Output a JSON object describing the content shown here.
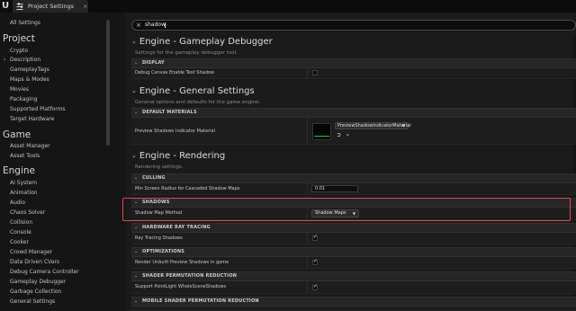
{
  "window": {
    "tab_title": "Project Settings",
    "close_glyph": "×"
  },
  "search": {
    "value": "shadow",
    "clear_glyph": "×"
  },
  "sidebar": {
    "top_link": "All Settings",
    "sections": [
      {
        "heading": "Project",
        "items": [
          "Crypto",
          "Description",
          "GameplayTags",
          "Maps & Modes",
          "Movies",
          "Packaging",
          "Supported Platforms",
          "Target Hardware"
        ],
        "current_item": "Description"
      },
      {
        "heading": "Game",
        "items": [
          "Asset Manager",
          "Asset Tools"
        ]
      },
      {
        "heading": "Engine",
        "items": [
          "AI System",
          "Animation",
          "Audio",
          "Chaos Solver",
          "Collision",
          "Console",
          "Cooker",
          "Crowd Manager",
          "Data Driven CVars",
          "Debug Camera Controller",
          "Gameplay Debugger",
          "Garbage Collection",
          "General Settings"
        ]
      }
    ]
  },
  "main": {
    "sections": [
      {
        "title": "Engine - Gameplay Debugger",
        "subtitle": "Settings for the gameplay debugger tool.",
        "categories": [
          {
            "label": "DISPLAY",
            "props": [
              {
                "label": "Debug Canvas Enable Text Shadow",
                "type": "checkbox",
                "checked": false
              }
            ]
          }
        ]
      },
      {
        "title": "Engine - General Settings",
        "subtitle": "General options and defaults for the game engine.",
        "categories": [
          {
            "label": "DEFAULT MATERIALS",
            "props": [
              {
                "label": "Preview Shadows Indicator Material",
                "type": "asset",
                "asset_name": "PreviewShadowIndicatorMaterial"
              }
            ]
          }
        ]
      },
      {
        "title": "Engine - Rendering",
        "subtitle": "Rendering settings.",
        "categories": [
          {
            "label": "CULLING",
            "props": [
              {
                "label": "Min Screen Radius for Cascaded Shadow Maps",
                "type": "number",
                "value": "0.01"
              }
            ]
          },
          {
            "label": "SHADOWS",
            "props": [
              {
                "label": "Shadow Map Method",
                "type": "dropdown",
                "value": "Shadow Maps"
              }
            ]
          },
          {
            "label": "HARDWARE RAY TRACING",
            "props": [
              {
                "label": "Ray Tracing Shadows",
                "type": "checkbox",
                "checked": true
              }
            ]
          },
          {
            "label": "OPTIMIZATIONS",
            "props": [
              {
                "label": "Render Unbuilt Preview Shadows in game",
                "type": "checkbox",
                "checked": true
              }
            ]
          },
          {
            "label": "SHADER PERMUTATION REDUCTION",
            "props": [
              {
                "label": "Support PointLight WholeSceneShadows",
                "type": "checkbox",
                "checked": true
              }
            ]
          },
          {
            "label": "MOBILE SHADER PERMUTATION REDUCTION",
            "props": []
          }
        ]
      }
    ]
  },
  "icons": {
    "collapse": "chevron-down-icon",
    "current_item": "chevron-right-icon",
    "browse": "arrow-right-circle-icon",
    "find": "search-icon",
    "dropdown": "caret-down-icon"
  },
  "colors": {
    "highlight_border": "#d14f5a",
    "thumbnail_accent": "#38c038"
  }
}
